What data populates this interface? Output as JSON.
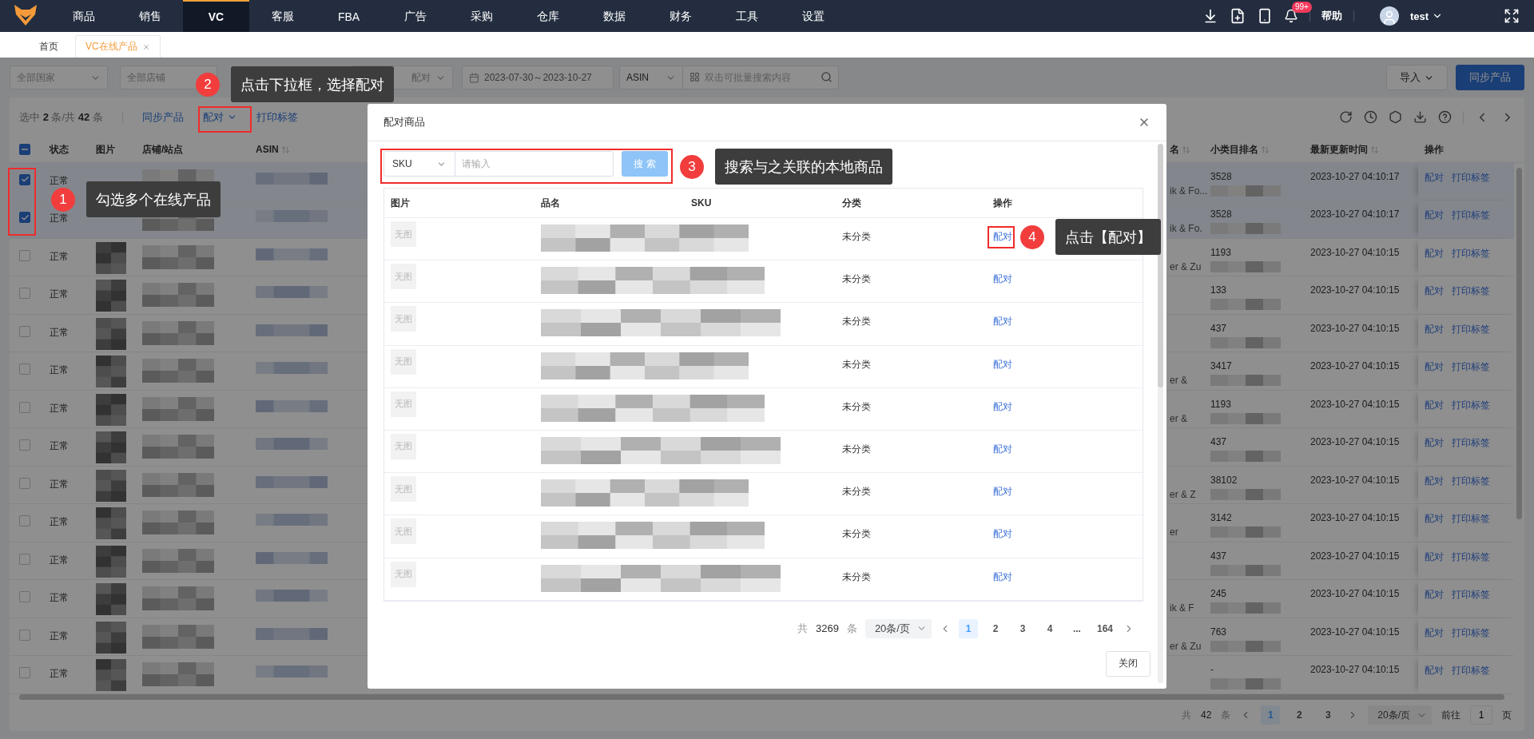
{
  "top_nav": {
    "items": [
      {
        "label": "商品",
        "selected": false
      },
      {
        "label": "销售",
        "selected": false
      },
      {
        "label": "VC",
        "selected": true
      },
      {
        "label": "客服",
        "selected": false
      },
      {
        "label": "FBA",
        "selected": false
      },
      {
        "label": "广告",
        "selected": false
      },
      {
        "label": "采购",
        "selected": false
      },
      {
        "label": "仓库",
        "selected": false
      },
      {
        "label": "数据",
        "selected": false
      },
      {
        "label": "财务",
        "selected": false
      },
      {
        "label": "工具",
        "selected": false
      },
      {
        "label": "设置",
        "selected": false
      }
    ],
    "badge": "99+",
    "help": "帮助",
    "user": "test"
  },
  "tabs": [
    {
      "label": "首页",
      "selected": false,
      "closable": false
    },
    {
      "label": "VC在线产品",
      "selected": true,
      "closable": true
    }
  ],
  "filters": {
    "country": "全部国家",
    "store": "全部店铺",
    "match": "配对",
    "date_range": "2023-07-30～2023-10-27",
    "search_type": "ASIN",
    "search_placeholder": "双击可批量搜索内容"
  },
  "header_buttons": [
    {
      "label": "导入",
      "kind": "dropdown"
    },
    {
      "label": "同步产品",
      "kind": "primary"
    }
  ],
  "toolbar": {
    "selection": "选中 **2** 条/共 **42** 条",
    "actions": [
      {
        "label": "同步产品",
        "kind": "link"
      },
      {
        "label": "配对",
        "kind": "dropdown"
      },
      {
        "label": "打印标签",
        "kind": "link"
      }
    ]
  },
  "table": {
    "indeterminate": true,
    "columns": [
      {
        "label": "状态",
        "sortable": false
      },
      {
        "label": "图片",
        "sortable": false
      },
      {
        "label": "店铺/站点",
        "sortable": false
      },
      {
        "label": "ASIN",
        "sortable": true
      },
      {
        "label": "名",
        "sortable": true
      },
      {
        "label": "小类目排名",
        "sortable": true
      },
      {
        "label": "最新更新时间",
        "sortable": true
      },
      {
        "label": "操作",
        "sortable": false
      }
    ],
    "rows": [
      {
        "checked": true,
        "status": "正常",
        "column_5": "ik & Fo...",
        "rank": "3528",
        "updated": "2023-10-27 04:10:17",
        "actions": [
          "配对",
          "打印标签"
        ]
      },
      {
        "checked": true,
        "status": "正常",
        "column_5": "ik & Fo.",
        "rank": "3528",
        "updated": "2023-10-27 04:10:17",
        "actions": [
          "配对",
          "打印标签"
        ]
      },
      {
        "checked": false,
        "status": "正常",
        "column_5": "er & Zu",
        "rank": "1193",
        "updated": "2023-10-27 04:10:15",
        "actions": [
          "配对",
          "打印标签"
        ]
      },
      {
        "checked": false,
        "status": "正常",
        "rank": "133",
        "updated": "2023-10-27 04:10:15",
        "actions": [
          "配对",
          "打印标签"
        ]
      },
      {
        "checked": false,
        "status": "正常",
        "rank": "437",
        "updated": "2023-10-27 04:10:15",
        "actions": [
          "配对",
          "打印标签"
        ]
      },
      {
        "checked": false,
        "status": "正常",
        "column_5": "er &",
        "rank": "3417",
        "updated": "2023-10-27 04:10:15",
        "actions": [
          "配对",
          "打印标签"
        ]
      },
      {
        "checked": false,
        "status": "正常",
        "column_5": "er &",
        "rank": "1193",
        "updated": "2023-10-27 04:10:15",
        "actions": [
          "配对",
          "打印标签"
        ]
      },
      {
        "checked": false,
        "status": "正常",
        "rank": "437",
        "updated": "2023-10-27 04:10:15",
        "actions": [
          "配对",
          "打印标签"
        ]
      },
      {
        "checked": false,
        "status": "正常",
        "column_5": "er & Z",
        "rank": "38102",
        "updated": "2023-10-27 04:10:15",
        "actions": [
          "配对",
          "打印标签"
        ]
      },
      {
        "checked": false,
        "status": "正常",
        "column_5": "er",
        "rank": "3142",
        "updated": "2023-10-27 04:10:15",
        "actions": [
          "配对",
          "打印标签"
        ]
      },
      {
        "checked": false,
        "status": "正常",
        "rank": "437",
        "updated": "2023-10-27 04:10:15",
        "actions": [
          "配对",
          "打印标签"
        ]
      },
      {
        "checked": false,
        "status": "正常",
        "column_5": "ik & F",
        "rank": "245",
        "updated": "2023-10-27 04:10:15",
        "actions": [
          "配对",
          "打印标签"
        ]
      },
      {
        "checked": false,
        "status": "正常",
        "column_5": "er & Zu",
        "rank": "763",
        "updated": "2023-10-27 04:10:15",
        "actions": [
          "配对",
          "打印标签"
        ]
      },
      {
        "checked": false,
        "status": "正常",
        "rank": "-",
        "updated": "2023-10-27 04:10:15",
        "actions": [
          "配对",
          "打印标签"
        ]
      }
    ]
  },
  "pagination": {
    "total_prefix": "共",
    "total": "42",
    "total_suffix": "条",
    "pages": [
      {
        "label": "1",
        "selected": true
      },
      {
        "label": "2",
        "selected": false
      },
      {
        "label": "3",
        "selected": false
      }
    ],
    "page_size": "20条/页",
    "goto_label": "前往",
    "goto_value": "1",
    "goto_suffix": "页"
  },
  "modal": {
    "title": "配对商品",
    "search": {
      "field": "SKU",
      "placeholder": "请输入",
      "button": "搜 索"
    },
    "columns": [
      "图片",
      "品名",
      "SKU",
      "分类",
      "操作"
    ],
    "rows": [
      {
        "image": "无图",
        "category": "未分类",
        "action": "配对"
      },
      {
        "image": "无图",
        "category": "未分类",
        "action": "配对"
      },
      {
        "image": "无图",
        "category": "未分类",
        "action": "配对"
      },
      {
        "image": "无图",
        "category": "未分类",
        "action": "配对"
      },
      {
        "image": "无图",
        "category": "未分类",
        "action": "配对"
      },
      {
        "image": "无图",
        "category": "未分类",
        "action": "配对"
      },
      {
        "image": "无图",
        "category": "未分类",
        "action": "配对"
      },
      {
        "image": "无图",
        "category": "未分类",
        "action": "配对"
      },
      {
        "image": "无图",
        "category": "未分类",
        "action": "配对"
      }
    ],
    "pagination": {
      "total_prefix": "共",
      "total": "3269",
      "total_suffix": "条",
      "page_size": "20条/页",
      "pages": [
        {
          "label": "1",
          "selected": true
        },
        {
          "label": "2",
          "selected": false
        },
        {
          "label": "3",
          "selected": false
        },
        {
          "label": "4",
          "selected": false
        },
        {
          "label": "...",
          "selected": false
        },
        {
          "label": "164",
          "selected": false
        }
      ]
    },
    "close_button": "关闭"
  },
  "annotations": [
    {
      "number": "1",
      "text": "勾选多个在线产品"
    },
    {
      "number": "2",
      "text": "点击下拉框，选择配对"
    },
    {
      "number": "3",
      "text": "搜索与之关联的本地商品"
    },
    {
      "number": "4",
      "text": "点击【配对】"
    }
  ]
}
